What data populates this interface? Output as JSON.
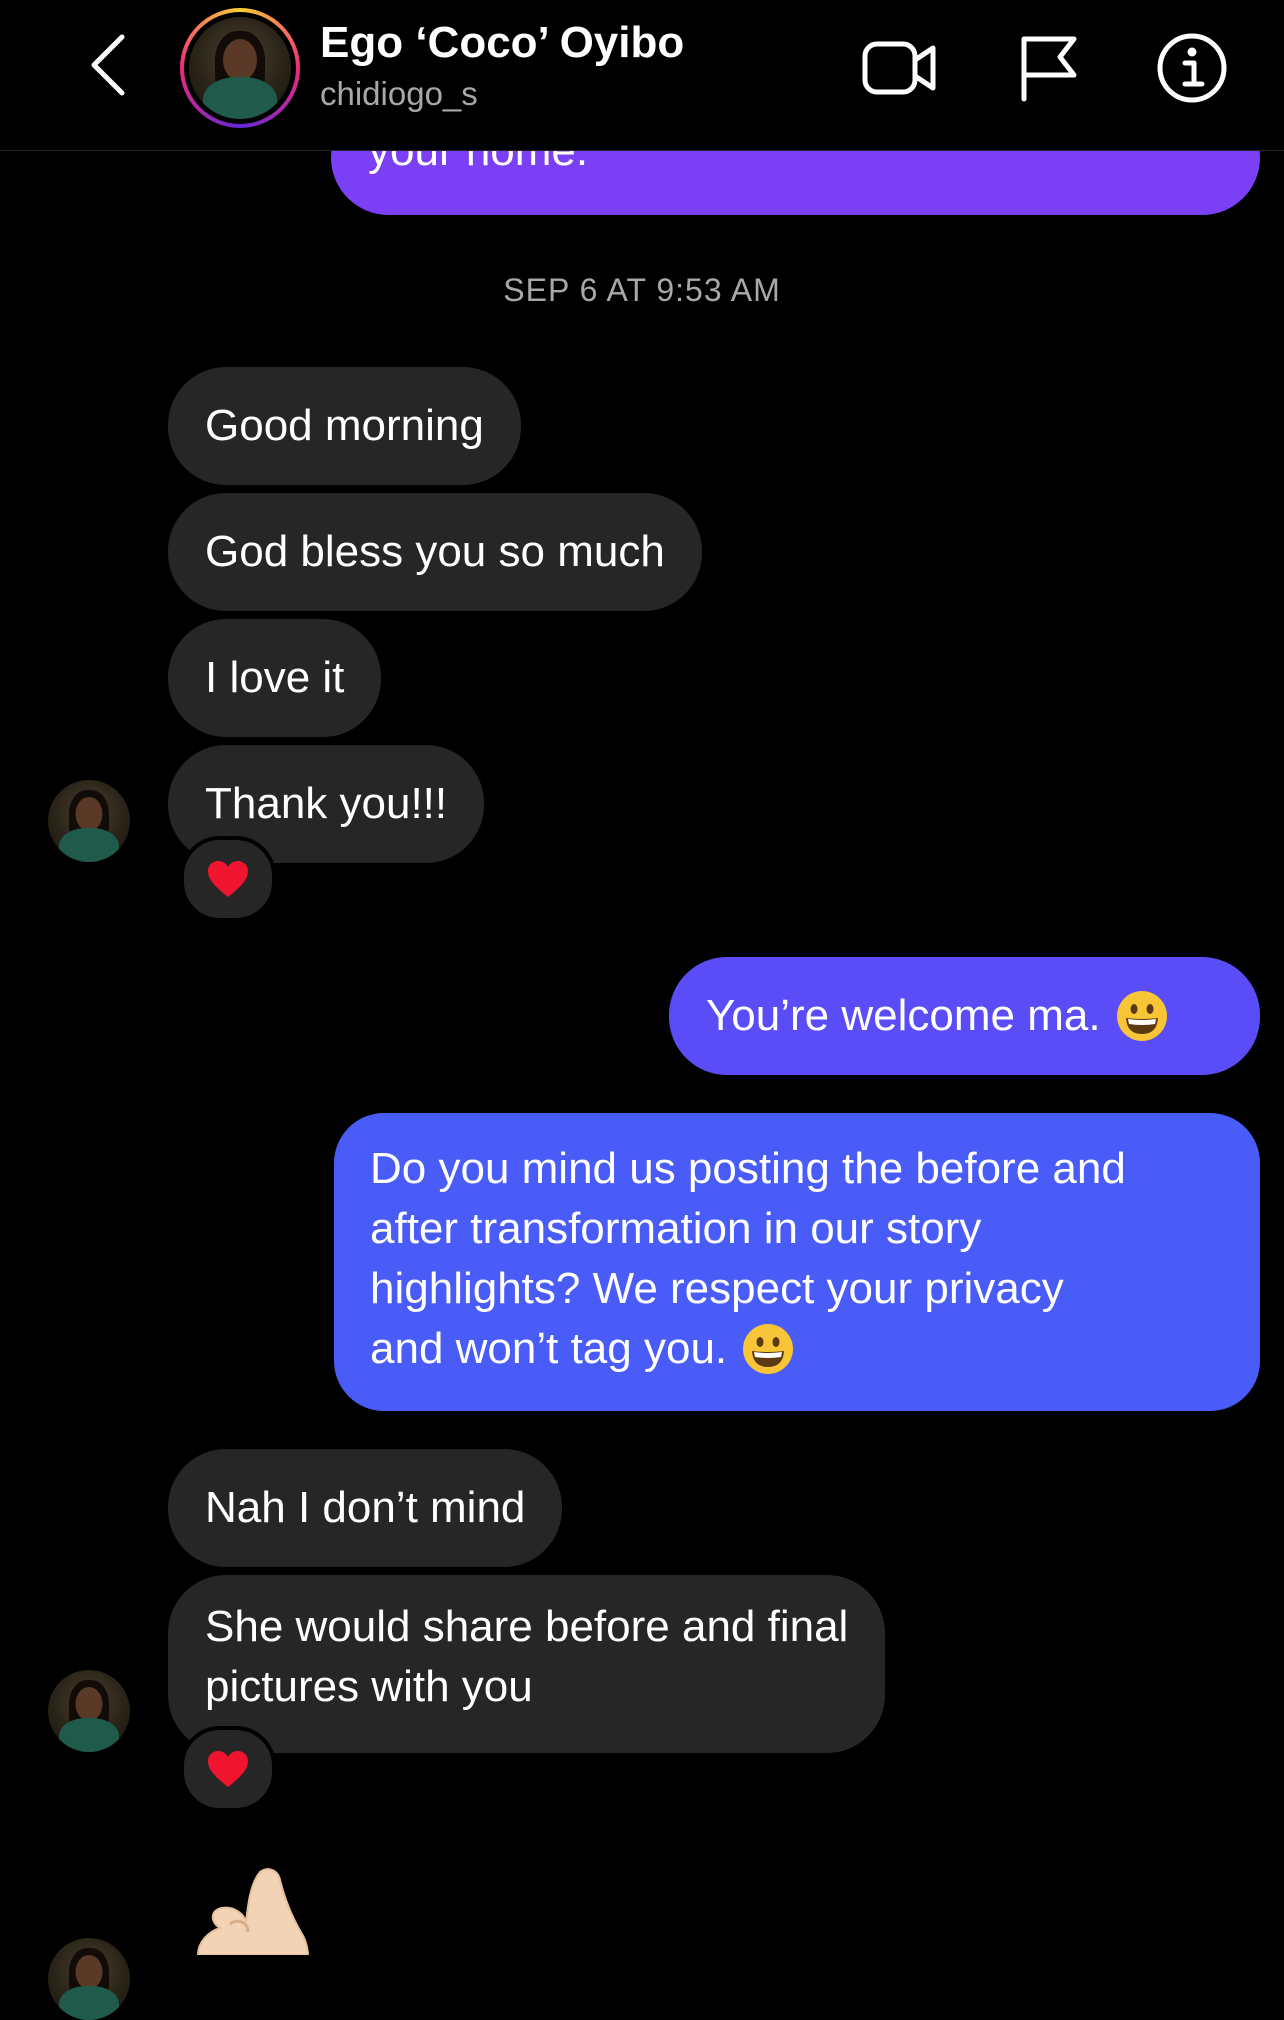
{
  "header": {
    "name": "Ego ‘Coco’ Oyibo",
    "username": "chidiogo_s"
  },
  "top_partial_message": "your home.",
  "timestamp": "SEP 6 AT 9:53 AM",
  "messages_group1": [
    "Good morning",
    "God bless you so much",
    "I love it",
    "Thank you!!!"
  ],
  "outgoing": {
    "welcome": "You’re welcome ma.",
    "question_lines": [
      "Do you mind us posting the before and",
      "after transformation in our story",
      "highlights? We respect your privacy",
      "and won’t tag you."
    ]
  },
  "messages_group2": [
    "Nah I don’t mind"
  ],
  "share_lines": [
    "She would share before and  final",
    "pictures with you"
  ],
  "reaction_emoji": "heart",
  "colors": {
    "incoming_bubble": "#262626",
    "outgoing_purple": "#7b3ff6",
    "outgoing_blue": "#4a5cf7",
    "muted_text": "#a8a8a8"
  }
}
